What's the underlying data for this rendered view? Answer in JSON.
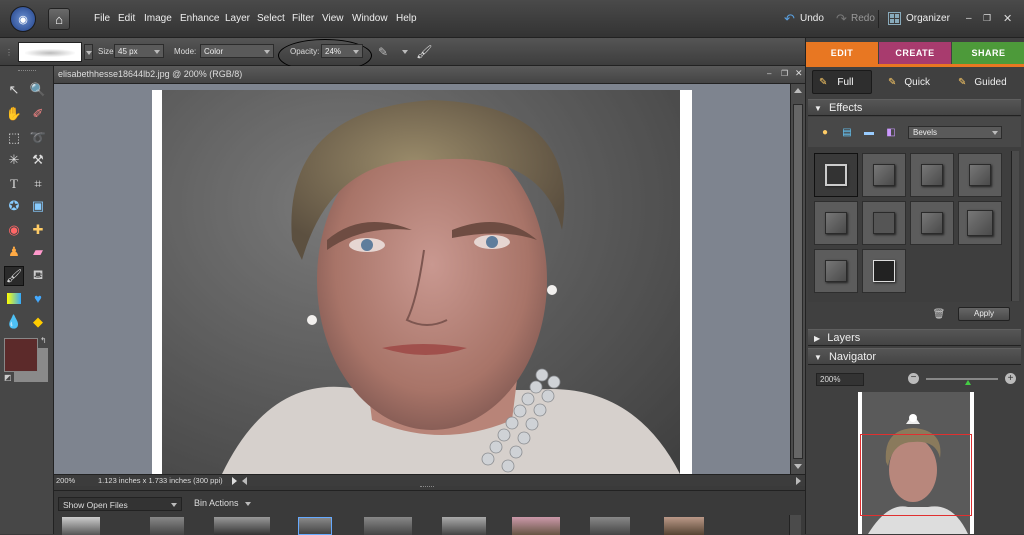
{
  "menubar": {
    "items": [
      "File",
      "Edit",
      "Image",
      "Enhance",
      "Layer",
      "Select",
      "Filter",
      "View",
      "Window",
      "Help"
    ],
    "undo_label": "Undo",
    "redo_label": "Redo",
    "organizer_label": "Organizer"
  },
  "options": {
    "size_label": "Size:",
    "size_value": "45 px",
    "mode_label": "Mode:",
    "mode_value": "Color",
    "opacity_label": "Opacity:",
    "opacity_value": "24%"
  },
  "document": {
    "title": "elisabethhesse18644lb2.jpg @ 200% (RGB/8)",
    "zoom": "200%",
    "dimensions": "1.123 inches x 1.733 inches (300 ppi)"
  },
  "bin": {
    "show_label": "Show Open Files",
    "actions_label": "Bin Actions"
  },
  "modes": {
    "edit": "EDIT",
    "create": "CREATE",
    "share": "SHARE",
    "full": "Full",
    "quick": "Quick",
    "guided": "Guided"
  },
  "effects": {
    "header": "Effects",
    "category": "Bevels",
    "apply_label": "Apply"
  },
  "layers": {
    "header": "Layers"
  },
  "navigator": {
    "header": "Navigator",
    "zoom": "200%"
  },
  "colors": {
    "foreground": "#5c2a2a",
    "background": "#8a8a8a",
    "edit_tab": "#e87722",
    "create_tab": "#a83b6e",
    "share_tab": "#4d9a3a"
  }
}
